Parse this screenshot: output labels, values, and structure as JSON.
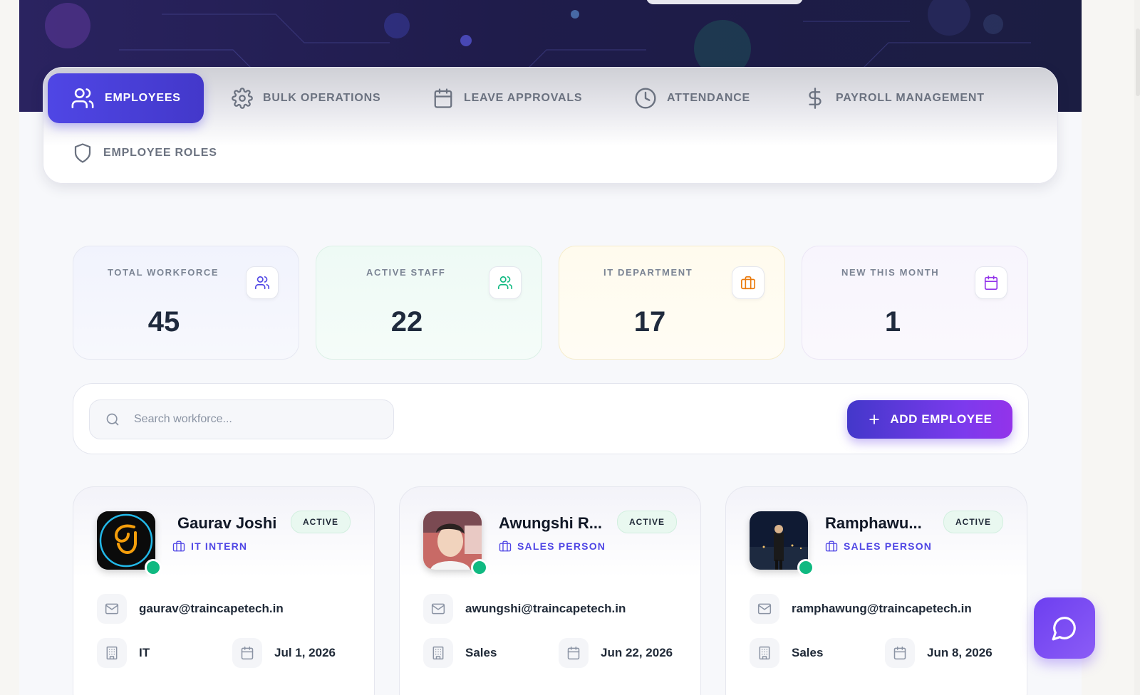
{
  "tabs": [
    {
      "label": "EMPLOYEES",
      "icon": "users-icon",
      "active": true
    },
    {
      "label": "BULK OPERATIONS",
      "icon": "gear-icon"
    },
    {
      "label": "LEAVE APPROVALS",
      "icon": "calendar-icon"
    },
    {
      "label": "ATTENDANCE",
      "icon": "clock-icon"
    },
    {
      "label": "PAYROLL MANAGEMENT",
      "icon": "dollar-icon"
    },
    {
      "label": "EMPLOYEE ROLES",
      "icon": "shield-icon"
    }
  ],
  "stats": [
    {
      "label": "TOTAL WORKFORCE",
      "value": "45",
      "icon": "users-icon",
      "color": "#4f46e5"
    },
    {
      "label": "ACTIVE STAFF",
      "value": "22",
      "icon": "users-icon",
      "color": "#10b981"
    },
    {
      "label": "IT DEPARTMENT",
      "value": "17",
      "icon": "briefcase-icon",
      "color": "#ea7a0c"
    },
    {
      "label": "NEW THIS MONTH",
      "value": "1",
      "icon": "calendar-icon",
      "color": "#9333ea"
    }
  ],
  "search": {
    "placeholder": "Search workforce..."
  },
  "add_button": {
    "label": "ADD EMPLOYEE"
  },
  "employees": [
    {
      "name": "Gaurav Joshi",
      "status": "ACTIVE",
      "role": "IT INTERN",
      "email": "gaurav@traincapetech.in",
      "department": "IT",
      "date": "Jul 1, 2026"
    },
    {
      "name": "Awungshi R...",
      "status": "ACTIVE",
      "role": "SALES PERSON",
      "email": "awungshi@traincapetech.in",
      "department": "Sales",
      "date": "Jun 22, 2026"
    },
    {
      "name": "Ramphawu...",
      "status": "ACTIVE",
      "role": "SALES PERSON",
      "email": "ramphawung@traincapetech.in",
      "department": "Sales",
      "date": "Jun 8, 2026"
    }
  ],
  "colors": {
    "accent": "#4f46e5",
    "online": "#10b981"
  }
}
